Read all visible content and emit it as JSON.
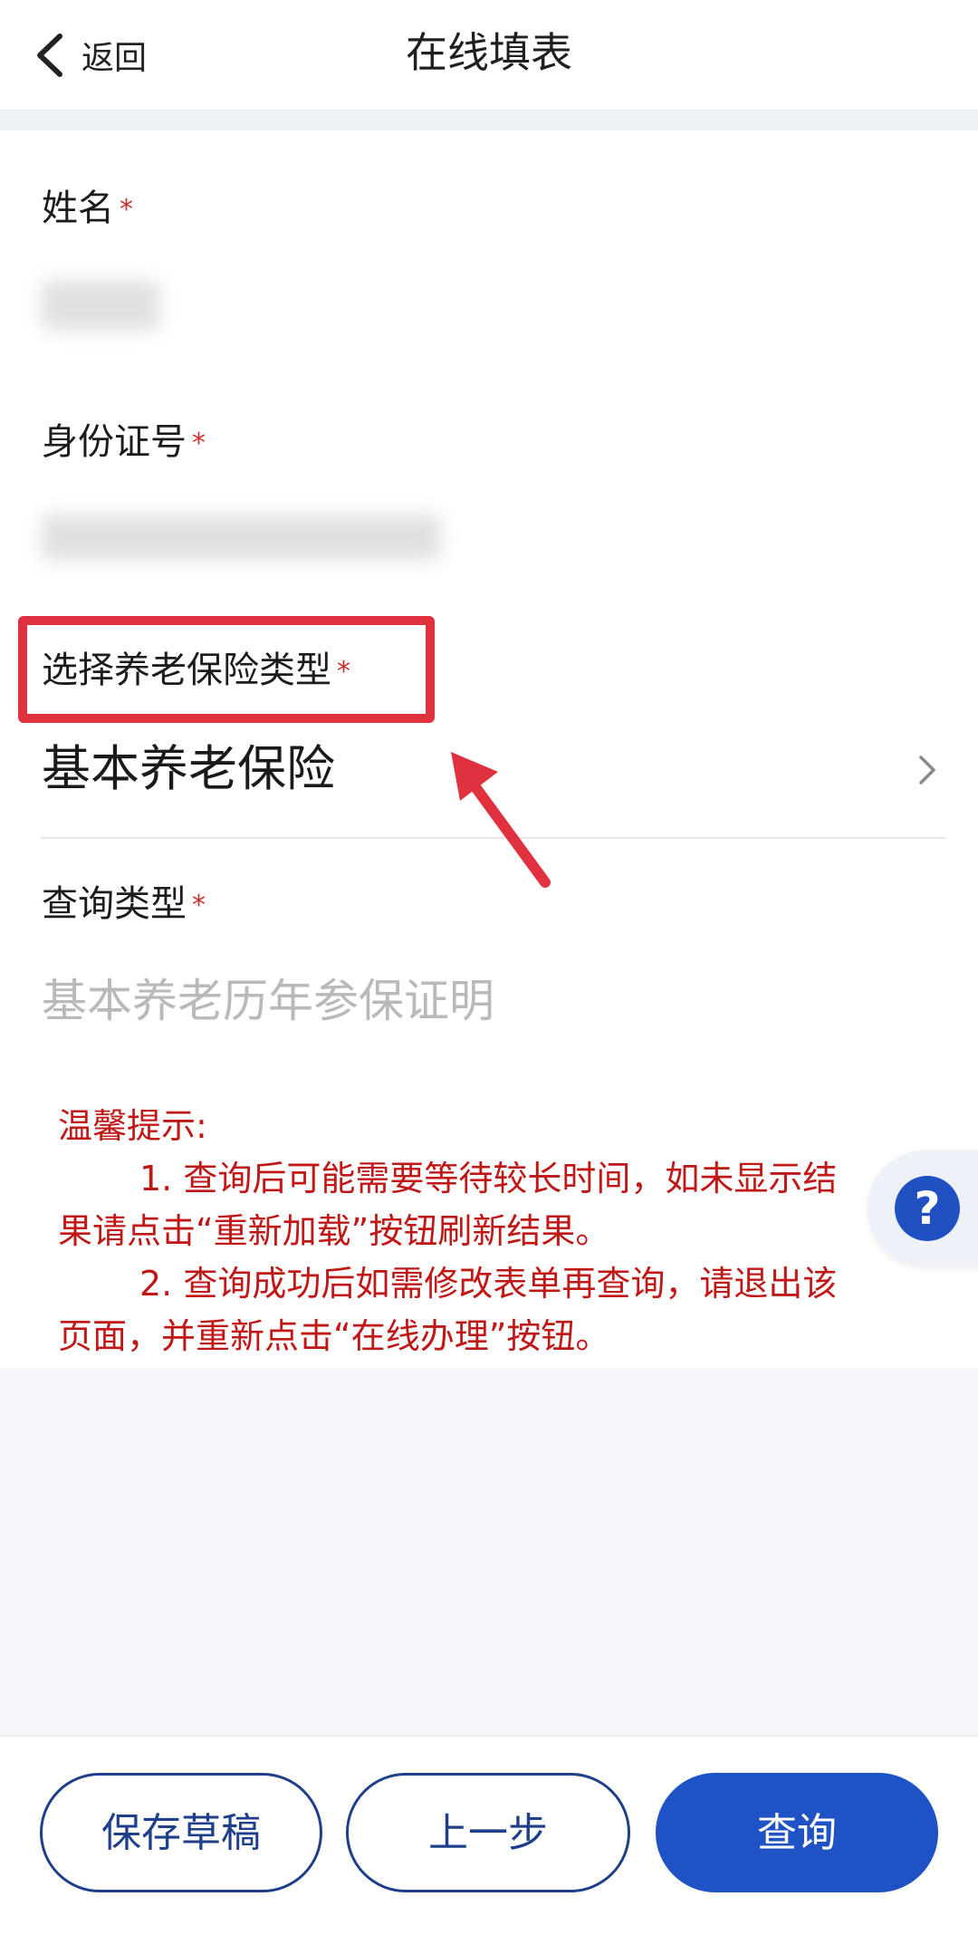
{
  "header": {
    "back_label": "返回",
    "title": "在线填表"
  },
  "form": {
    "name_label": "姓名",
    "id_label": "身份证号",
    "insurance_type_label": "选择养老保险类型",
    "insurance_type_value": "基本养老保险",
    "query_type_label": "查询类型",
    "query_type_placeholder": "基本养老历年参保证明",
    "required_mark": "*"
  },
  "tips": {
    "heading": "温馨提示:",
    "line1": "1. 查询后可能需要等待较长时间，如未显示结",
    "line1b": "果请点击“重新加载”按钮刷新结果。",
    "line2": "2. 查询成功后如需修改表单再查询，请退出该",
    "line2b": "页面，并重新点击“在线办理”按钮。"
  },
  "help": {
    "label": "?"
  },
  "bottom": {
    "save_draft": "保存草稿",
    "prev_step": "上一步",
    "query": "查询"
  },
  "colors": {
    "primary": "#1f52c4",
    "required": "#c9302c",
    "tips": "#c01717",
    "highlight": "#e0323e"
  }
}
